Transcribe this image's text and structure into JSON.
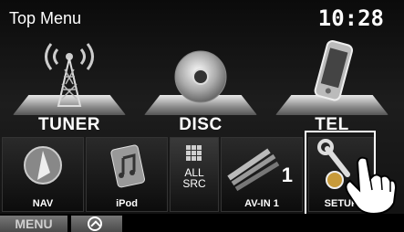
{
  "header": {
    "title": "Top Menu",
    "clock": "10:28"
  },
  "main_sources": [
    {
      "label": "TUNER",
      "icon": "radio-tower-icon"
    },
    {
      "label": "DISC",
      "icon": "disc-icon"
    },
    {
      "label": "TEL",
      "icon": "phone-icon"
    }
  ],
  "tiles": [
    {
      "label": "NAV",
      "icon": "navigation-arrow-icon"
    },
    {
      "label": "iPod",
      "icon": "ipod-music-icon"
    },
    {
      "label_line1": "ALL",
      "label_line2": "SRC",
      "icon": "grid-icon"
    },
    {
      "label": "AV-IN 1",
      "badge": "1",
      "icon": "av-cable-icon"
    },
    {
      "label": "SETUP",
      "icon": "wrench-icon"
    }
  ],
  "bottom_bar": {
    "menu_label": "MENU"
  },
  "colors": {
    "highlight": "#ffffff",
    "text": "#ffffff",
    "background": "#111111"
  }
}
